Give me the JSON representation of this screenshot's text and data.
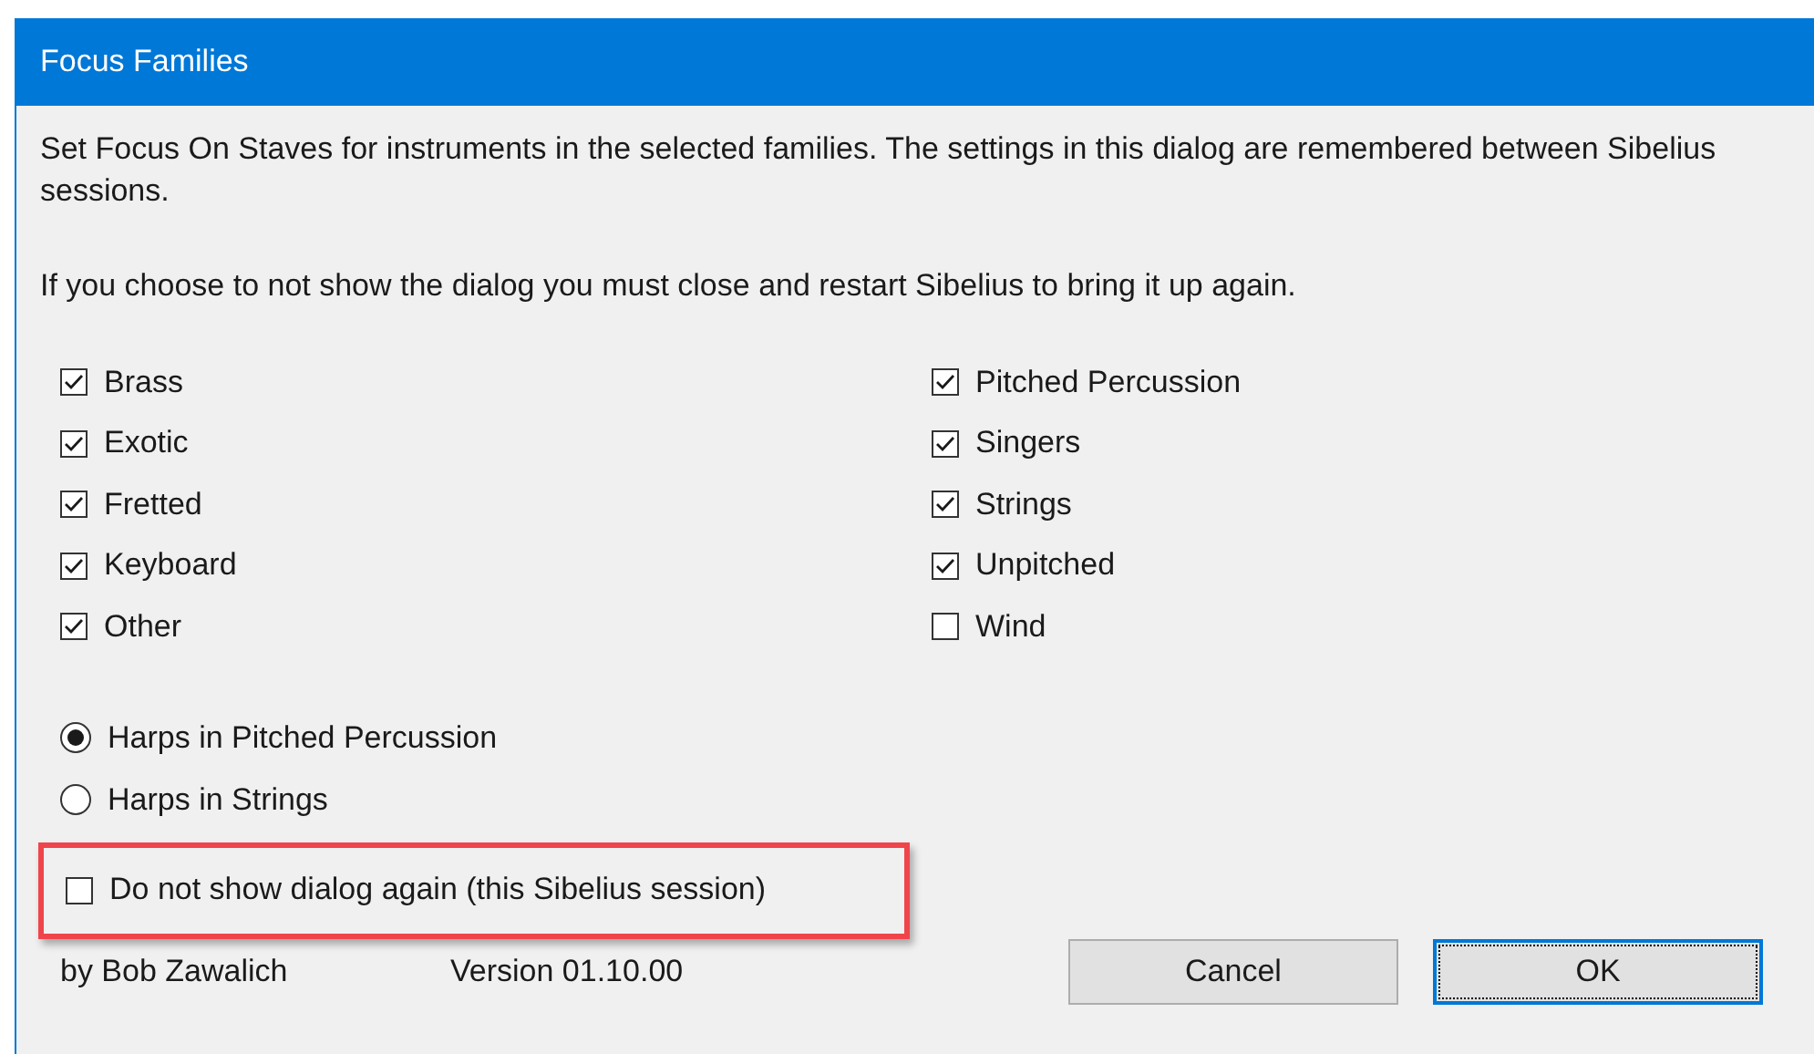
{
  "window": {
    "title": "Focus Families"
  },
  "description": [
    "Set Focus On Staves for instruments in the selected families. The settings in this dialog are remembered between Sibelius sessions.",
    "If you choose to not show the dialog you must close and restart Sibelius to bring it up again."
  ],
  "families": [
    {
      "label": "Brass",
      "checked": true
    },
    {
      "label": "Exotic",
      "checked": true
    },
    {
      "label": "Fretted",
      "checked": true
    },
    {
      "label": "Keyboard",
      "checked": true
    },
    {
      "label": "Other",
      "checked": true
    },
    {
      "label": "Pitched Percussion",
      "checked": true
    },
    {
      "label": "Singers",
      "checked": true
    },
    {
      "label": "Strings",
      "checked": true
    },
    {
      "label": "Unpitched",
      "checked": true
    },
    {
      "label": "Wind",
      "checked": false
    }
  ],
  "harp_options": [
    {
      "label": "Harps in Pitched Percussion",
      "selected": true
    },
    {
      "label": "Harps in Strings",
      "selected": false
    }
  ],
  "do_not_show": {
    "label": "Do not show dialog again (this Sibelius session)",
    "checked": false,
    "highlighted": true
  },
  "footer": {
    "author": "by Bob Zawalich",
    "version": "Version 01.10.00"
  },
  "buttons": [
    {
      "label": "Cancel",
      "default": false
    },
    {
      "label": "OK",
      "default": true
    }
  ]
}
